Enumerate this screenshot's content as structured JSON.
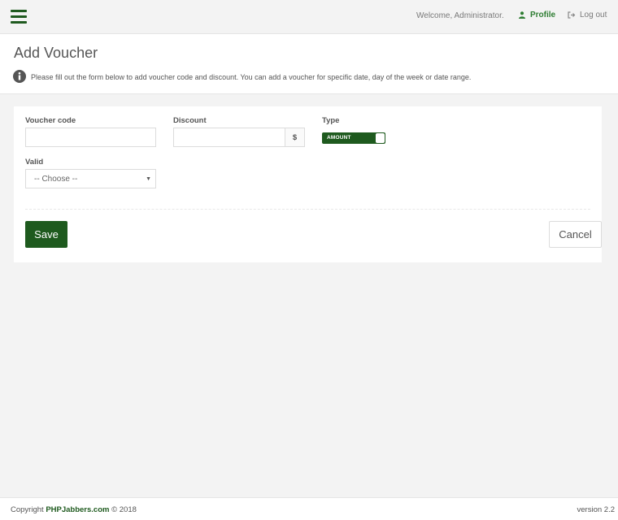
{
  "topbar": {
    "menu_icon": "hamburger-icon",
    "welcome": "Welcome, Administrator.",
    "profile_label": "Profile",
    "profile_icon": "user-icon",
    "logout_label": "Log out",
    "logout_icon": "sign-out-icon"
  },
  "header": {
    "title": "Add Voucher",
    "info_icon": "info-icon",
    "info_text": "Please fill out the form below to add voucher code and discount. You can add a voucher for specific date, day of the week or date range."
  },
  "form": {
    "voucher_code_label": "Voucher code",
    "voucher_code_value": "",
    "discount_label": "Discount",
    "discount_value": "",
    "currency_symbol": "$",
    "type_label": "Type",
    "type_toggle_label": "AMOUNT",
    "valid_label": "Valid",
    "valid_selected": "-- Choose --",
    "save_label": "Save",
    "cancel_label": "Cancel"
  },
  "footer": {
    "copyright_prefix": "Copyright ",
    "brand": "PHPJabbers.com",
    "copyright_suffix": " © 2018",
    "version": "version 2.2"
  },
  "colors": {
    "accent": "#1e5a1e",
    "link_green": "#2e7d32",
    "background": "#f3f3f3"
  }
}
